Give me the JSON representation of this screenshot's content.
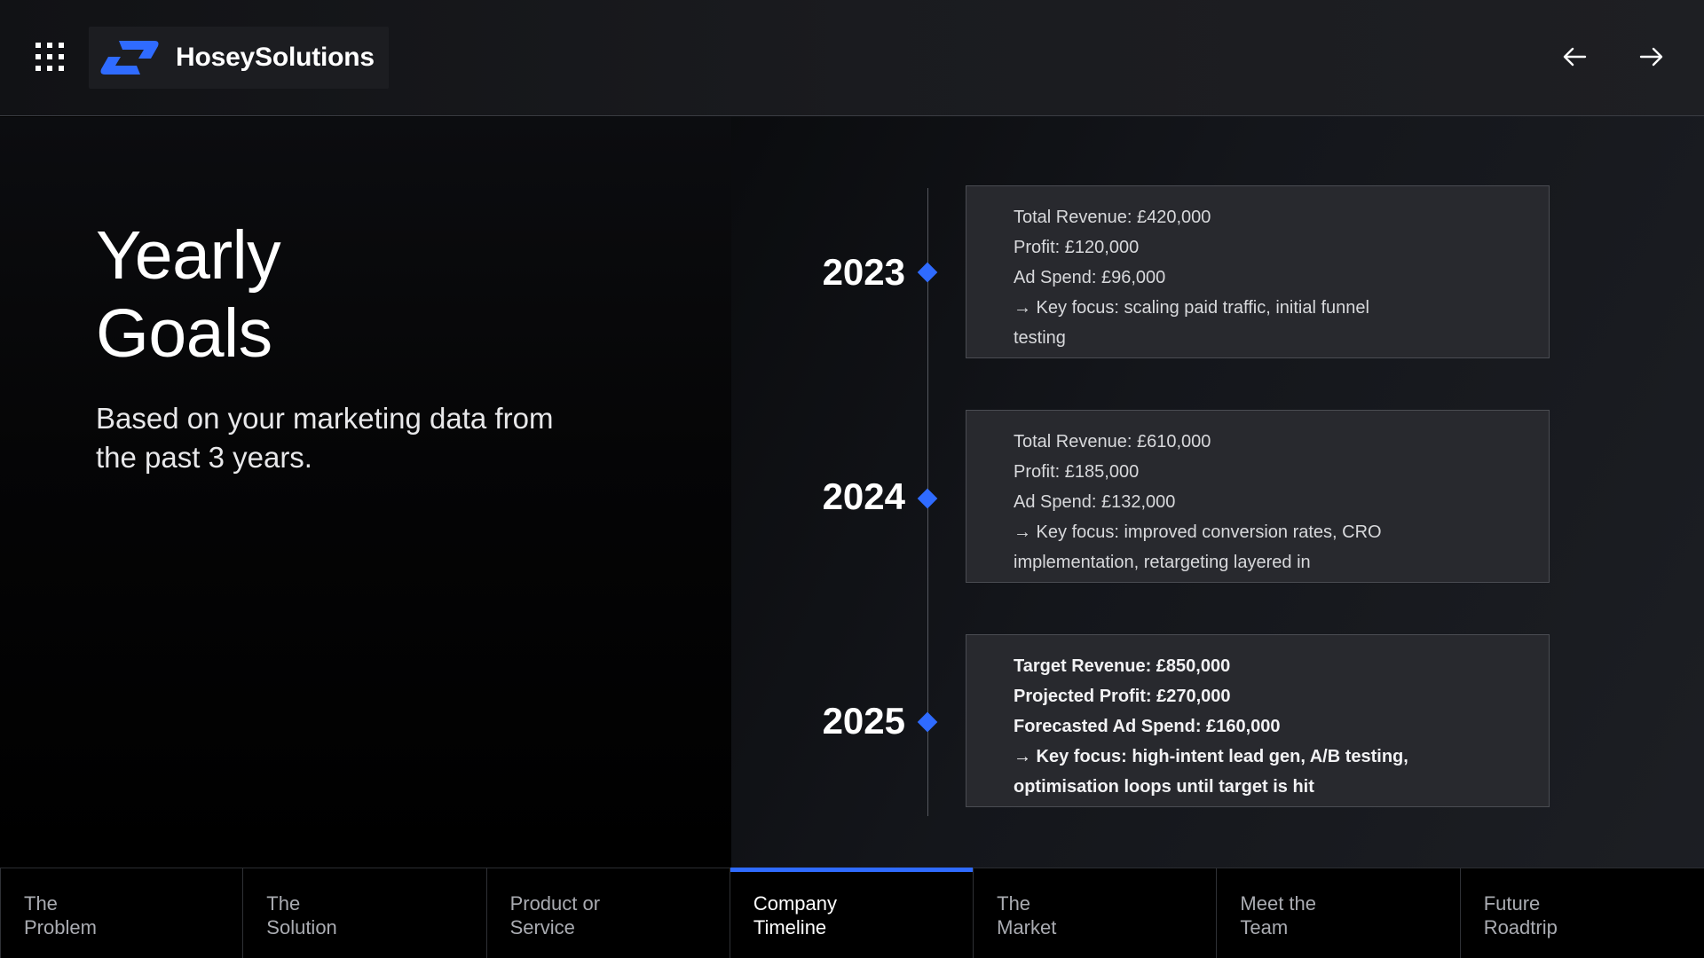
{
  "header": {
    "brand_name": "HoseySolutions",
    "accent_color": "#2f6bff",
    "menu_icon": "grid-menu-icon",
    "prev_icon": "arrow-left-icon",
    "next_icon": "arrow-right-icon"
  },
  "hero": {
    "title_line1": "Yearly",
    "title_line2": "Goals",
    "subtitle_line1": "Based on your marketing data from",
    "subtitle_line2": "the past 3 years."
  },
  "timeline": [
    {
      "year": "2023",
      "lines": [
        "Total Revenue: £420,000",
        "Profit: £120,000",
        "Ad Spend: £96,000",
        "→ Key focus: scaling paid traffic, initial funnel",
        "testing"
      ]
    },
    {
      "year": "2024",
      "lines": [
        "Total Revenue: £610,000",
        "Profit: £185,000",
        "Ad Spend: £132,000",
        "→ Key focus: improved conversion rates, CRO",
        "implementation, retargeting layered in"
      ]
    },
    {
      "year": "2025",
      "lines": [
        "Target Revenue: £850,000",
        "Projected Profit: £270,000",
        "Forecasted Ad Spend: £160,000",
        "→ Key focus: high-intent lead gen, A/B testing,",
        "optimisation loops until target is hit"
      ]
    }
  ],
  "tabs": [
    {
      "line1": "The",
      "line2": "Problem"
    },
    {
      "line1": "The",
      "line2": "Solution"
    },
    {
      "line1": "Product or",
      "line2": "Service"
    },
    {
      "line1": "Company",
      "line2": "Timeline",
      "active": true
    },
    {
      "line1": "The",
      "line2": "Market"
    },
    {
      "line1": "Meet the",
      "line2": "Team"
    },
    {
      "line1": "Future",
      "line2": "Roadtrip"
    }
  ]
}
